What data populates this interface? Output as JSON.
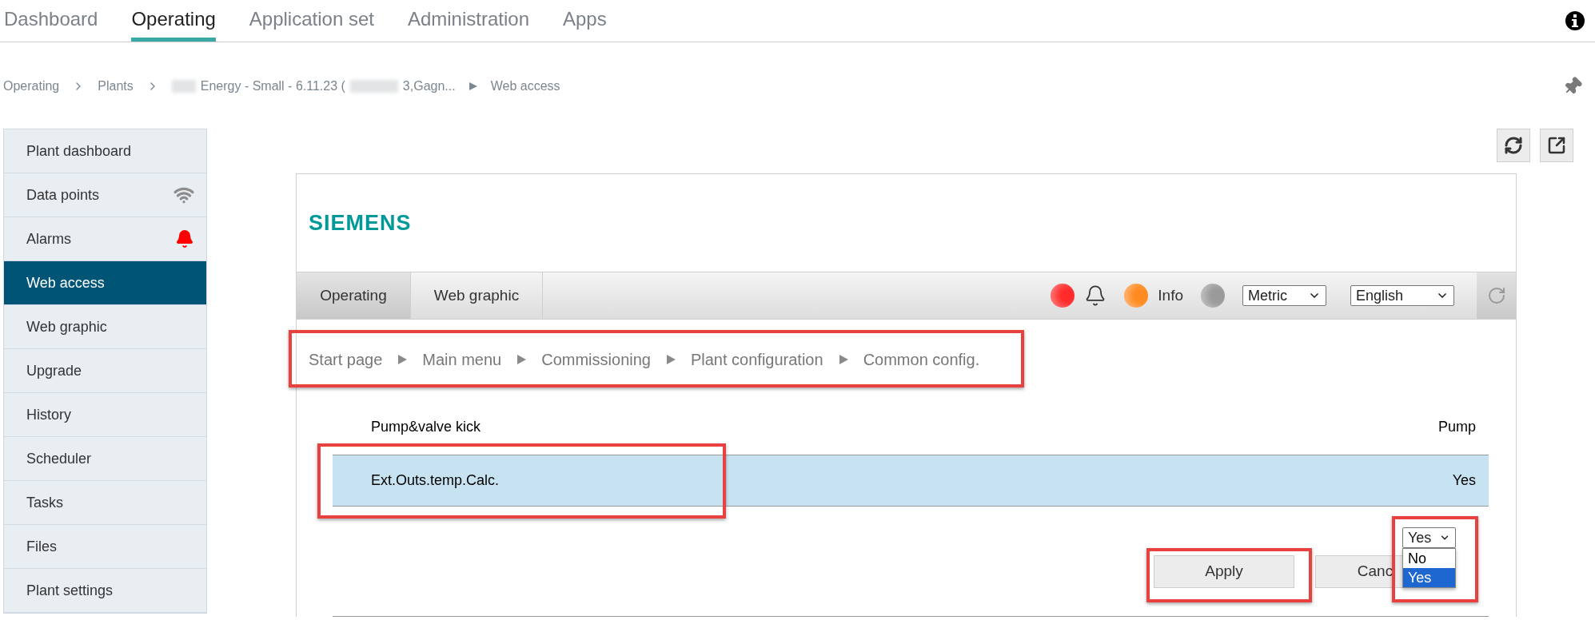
{
  "top_nav": [
    {
      "label": "Dashboard",
      "selected": false
    },
    {
      "label": "Operating",
      "selected": true
    },
    {
      "label": "Application set",
      "selected": false
    },
    {
      "label": "Administration",
      "selected": false
    },
    {
      "label": "Apps",
      "selected": false
    }
  ],
  "breadcrumb": [
    {
      "parts": [
        "Operating"
      ],
      "kind": "chevron"
    },
    {
      "parts": [
        "Plants"
      ],
      "kind": "chevron"
    },
    {
      "parts": [
        "Energy - Small - 6.11.23 (",
        "3,Gagn..."
      ],
      "redacted": true,
      "kind": "triangle"
    },
    {
      "parts": [
        "Web access"
      ],
      "kind": "last"
    }
  ],
  "sidebar": {
    "items": [
      {
        "label": "Plant dashboard",
        "selected": false,
        "kind": "plain"
      },
      {
        "label": "Data points",
        "selected": false,
        "kind": "wifi"
      },
      {
        "label": "Alarms",
        "selected": false,
        "kind": "bell"
      },
      {
        "label": "Web access",
        "selected": true,
        "kind": "plain"
      },
      {
        "label": "Web graphic",
        "selected": false,
        "kind": "plain"
      },
      {
        "label": "Upgrade",
        "selected": false,
        "kind": "plain"
      },
      {
        "label": "History",
        "selected": false,
        "kind": "plain"
      },
      {
        "label": "Scheduler",
        "selected": false,
        "kind": "plain"
      },
      {
        "label": "Tasks",
        "selected": false,
        "kind": "plain"
      },
      {
        "label": "Files",
        "selected": false,
        "kind": "plain"
      },
      {
        "label": "Plant settings",
        "selected": false,
        "kind": "plain"
      }
    ]
  },
  "web_access": {
    "logo": "SIEMENS",
    "tabs": [
      {
        "label": "Operating",
        "selected": true
      },
      {
        "label": "Web graphic",
        "selected": false
      }
    ],
    "indicators": [
      {
        "kind": "dot",
        "color": "#ff2a2a"
      },
      {
        "kind": "bell"
      },
      {
        "kind": "dot",
        "color": "#ff8a20"
      },
      {
        "kind": "label",
        "label": "Info"
      },
      {
        "kind": "dot",
        "color": "#9a9a9a"
      }
    ],
    "unit_select": "Metric",
    "language_select": "English",
    "path": {
      "items": [
        "Start page",
        "Main menu",
        "Commissioning",
        "Plant configuration",
        "Common config."
      ],
      "annotated": true
    },
    "table": {
      "columns": [
        "Pump&valve kick",
        "Pump"
      ],
      "rows": [
        {
          "cells": [
            "Ext.Outs.temp.Calc.",
            "Yes"
          ],
          "selected": true,
          "annotated": true
        }
      ]
    },
    "value_select": {
      "value": "Yes",
      "expanded": true,
      "annotated": true,
      "options": [
        {
          "label": "No",
          "selected": false
        },
        {
          "label": "Yes",
          "selected": true
        }
      ]
    },
    "buttons": [
      {
        "label": "Apply",
        "annotated": true
      },
      {
        "label": "Canc",
        "annotated": false
      }
    ]
  }
}
